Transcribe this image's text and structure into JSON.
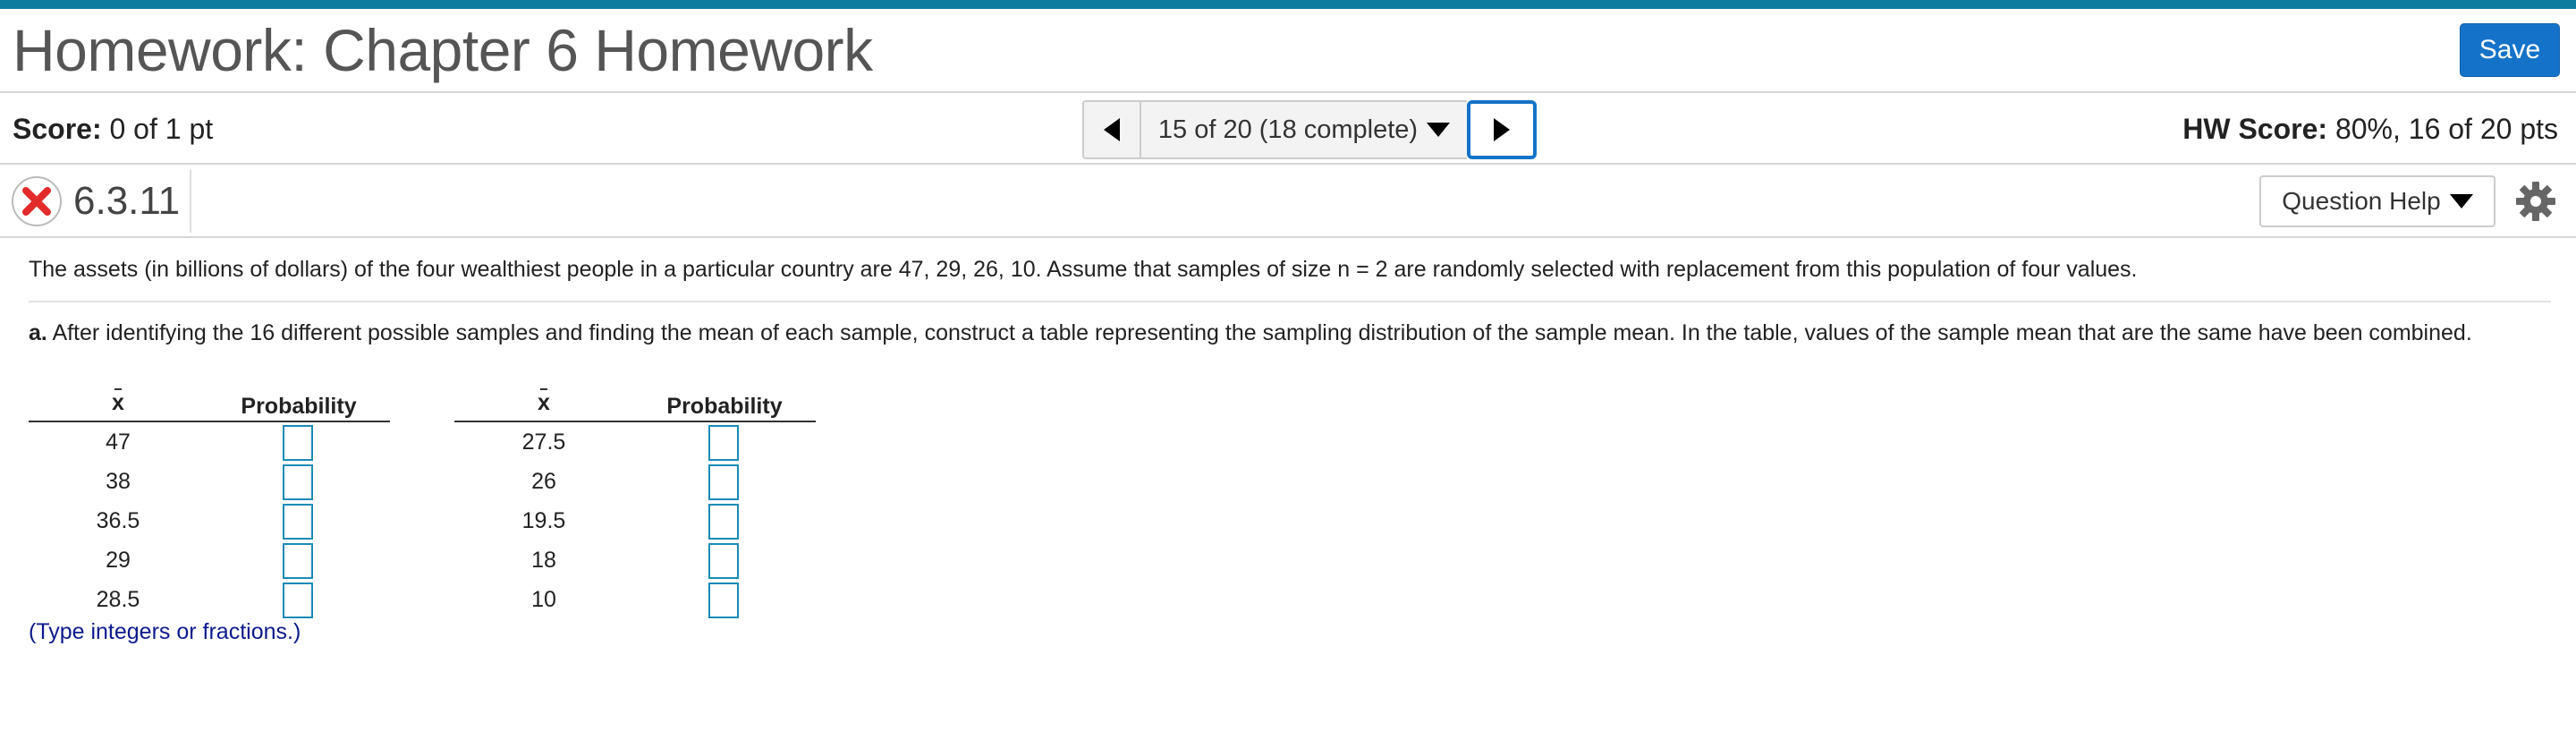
{
  "header": {
    "title": "Homework: Chapter 6 Homework",
    "save_label": "Save"
  },
  "score": {
    "label": "Score:",
    "value": "0 of 1 pt",
    "hw_label": "HW Score:",
    "hw_value": "80%, 16 of 20 pts"
  },
  "nav": {
    "progress": "15 of 20 (18 complete)"
  },
  "question": {
    "number": "6.3.11",
    "status": "incorrect",
    "help_label": "Question Help"
  },
  "content": {
    "intro": "The assets (in billions of dollars) of the four wealthiest people in a particular country are 47, 29, 26, 10. Assume that samples of size n = 2 are randomly selected with replacement from this population of four values.",
    "part_a_label": "a.",
    "part_a_text": "After identifying the 16 different possible samples and finding the mean of each sample, construct a table representing the sampling distribution of the sample mean. In the table, values of the sample mean that are the same have been combined.",
    "note": "(Type integers or fractions.)"
  },
  "tables": {
    "header_x": "x",
    "header_prob": "Probability",
    "left": [
      "47",
      "38",
      "36.5",
      "29",
      "28.5"
    ],
    "right": [
      "27.5",
      "26",
      "19.5",
      "18",
      "10"
    ]
  },
  "colors": {
    "accent": "#0e7c9e",
    "save_button": "#1473c9",
    "input_border": "#1a8bb5",
    "note_text": "#0b1a8c",
    "incorrect_icon": "#e32b2b"
  }
}
